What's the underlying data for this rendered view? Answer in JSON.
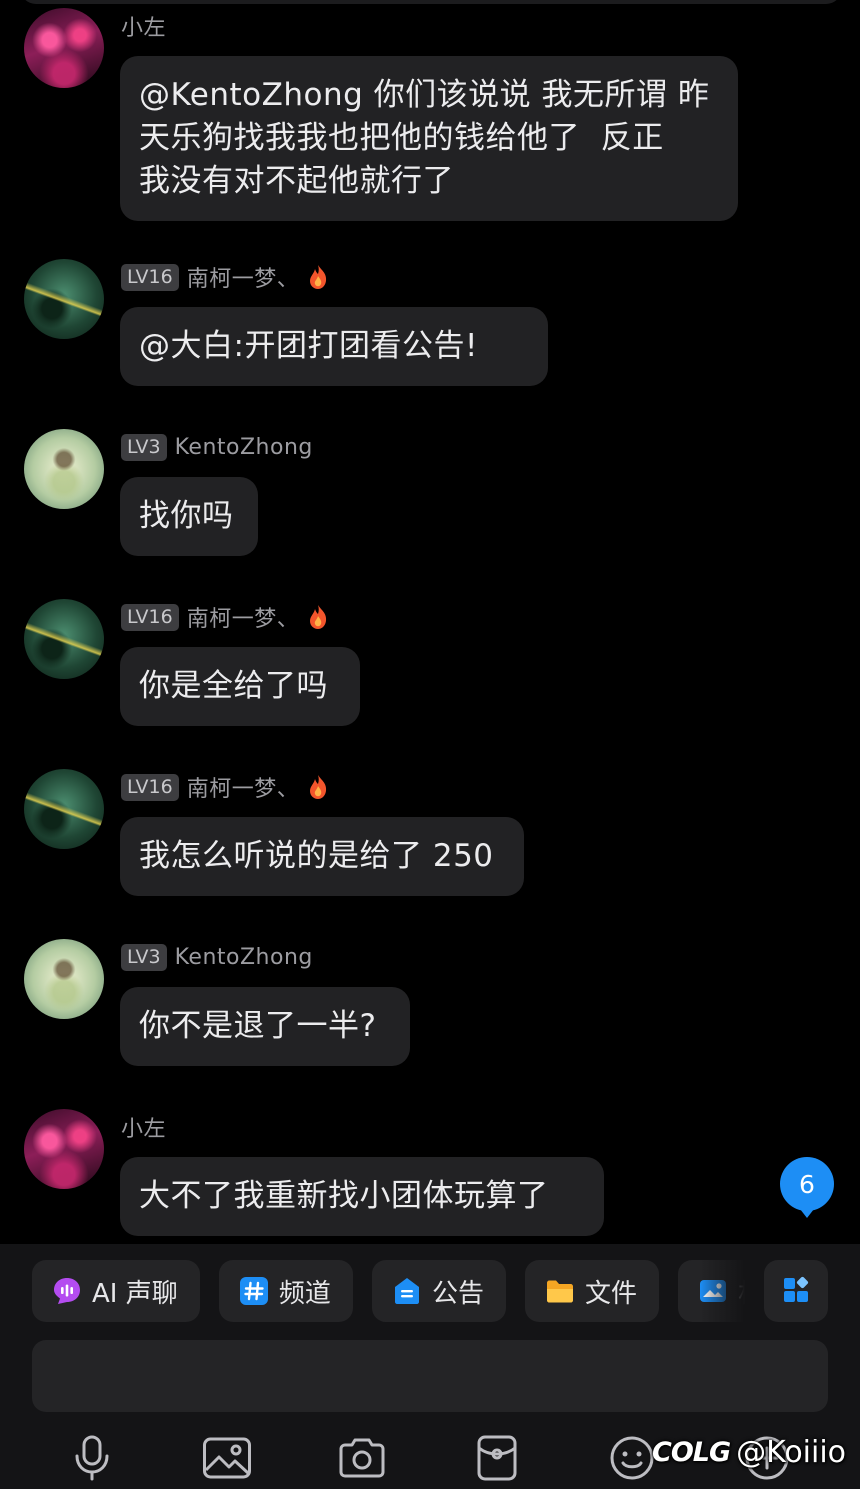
{
  "messages": [
    {
      "sender": "小左",
      "level": "",
      "avatar": "xiaozuo",
      "flame": false,
      "text": "@KentoZhong 你们该说说 我无所谓 昨\n天乐狗找我我也把他的钱给他了  反正\n我没有对不起他就行了"
    },
    {
      "sender": "南柯一梦、",
      "level": "LV16",
      "avatar": "nanke",
      "flame": true,
      "text": "@大白:开团打团看公告!"
    },
    {
      "sender": "KentoZhong",
      "level": "LV3",
      "avatar": "kento",
      "flame": false,
      "text": "找你吗"
    },
    {
      "sender": "南柯一梦、",
      "level": "LV16",
      "avatar": "nanke",
      "flame": true,
      "text": "你是全给了吗"
    },
    {
      "sender": "南柯一梦、",
      "level": "LV16",
      "avatar": "nanke",
      "flame": true,
      "text": "我怎么听说的是给了 250"
    },
    {
      "sender": "KentoZhong",
      "level": "LV3",
      "avatar": "kento",
      "flame": false,
      "text": "你不是退了一半?"
    },
    {
      "sender": "小左",
      "level": "",
      "avatar": "xiaozuo",
      "flame": false,
      "text": "大不了我重新找小团体玩算了"
    }
  ],
  "unread_count": "6",
  "quick_bar": {
    "ai_voice": "AI 声聊",
    "channel": "频道",
    "notice": "公告",
    "files": "文件",
    "partial": "相"
  },
  "input": {
    "value": ""
  },
  "toolbar": {
    "icons": [
      "microphone-icon",
      "image-icon",
      "camera-icon",
      "red-packet-icon",
      "emoji-icon",
      "plus-icon"
    ]
  },
  "watermark": {
    "logo": "COLG",
    "handle": "@Koiiio"
  },
  "colors": {
    "background": "#000000",
    "bubble": "#222224",
    "panel": "#141416",
    "accent_blue": "#1d8ef5",
    "ai_purple": "#b44cf0"
  }
}
